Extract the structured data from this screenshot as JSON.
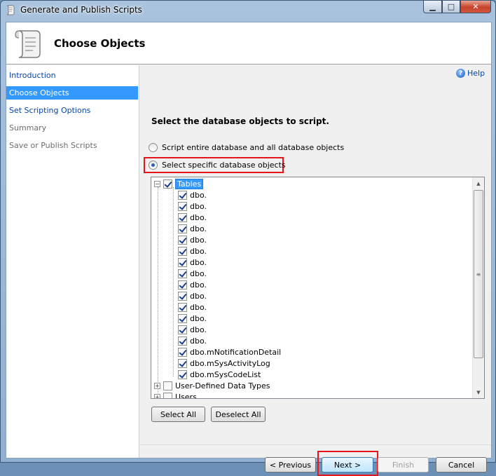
{
  "window": {
    "title": "Generate and Publish Scripts"
  },
  "header": {
    "title": "Choose Objects"
  },
  "nav": {
    "items": [
      {
        "label": "Introduction",
        "state": "link"
      },
      {
        "label": "Choose Objects",
        "state": "active"
      },
      {
        "label": "Set Scripting Options",
        "state": "link"
      },
      {
        "label": "Summary",
        "state": "disabled"
      },
      {
        "label": "Save or Publish Scripts",
        "state": "disabled"
      }
    ]
  },
  "help": {
    "label": "Help"
  },
  "main": {
    "section_title": "Select the database objects to script.",
    "radio_entire": "Script entire database and all database objects",
    "radio_specific": "Select specific database objects",
    "selected_option": "specific"
  },
  "tree": {
    "root_label": "Tables",
    "items": [
      "dbo.",
      "dbo.",
      "dbo.",
      "dbo.",
      "dbo.",
      "dbo.",
      "dbo.",
      "dbo.",
      "dbo.",
      "dbo.",
      "dbo.",
      "dbo.",
      "dbo.",
      "dbo.",
      "dbo.mNotificationDetail",
      "dbo.mSysActivityLog",
      "dbo.mSysCodeList"
    ],
    "groups": [
      "User-Defined Data Types",
      "Users"
    ]
  },
  "buttons": {
    "select_all": "Select All",
    "deselect_all": "Deselect All",
    "previous": "< Previous",
    "next": "Next >",
    "finish": "Finish",
    "cancel": "Cancel"
  },
  "colors": {
    "highlight": "#e8141c",
    "selection": "#3399ff",
    "link": "#0645ad"
  }
}
